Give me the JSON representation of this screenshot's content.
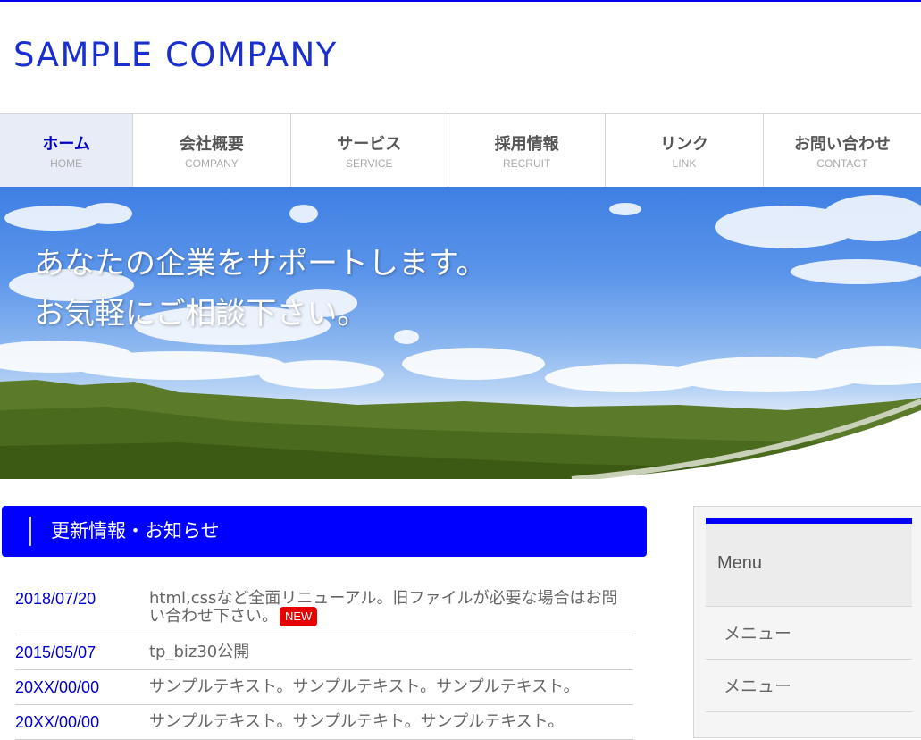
{
  "header": {
    "logo_text": "SAMPLE COMPANY"
  },
  "nav": {
    "items": [
      {
        "label": "ホーム",
        "sub": "HOME",
        "active": true
      },
      {
        "label": "会社概要",
        "sub": "COMPANY",
        "active": false
      },
      {
        "label": "サービス",
        "sub": "SERVICE",
        "active": false
      },
      {
        "label": "採用情報",
        "sub": "RECRUIT",
        "active": false
      },
      {
        "label": "リンク",
        "sub": "LINK",
        "active": false
      },
      {
        "label": "お問い合わせ",
        "sub": "CONTACT",
        "active": false
      }
    ]
  },
  "hero": {
    "line1": "あなたの企業をサポートします。",
    "line2": "お気軽にご相談下さい。"
  },
  "news": {
    "heading": "更新情報・お知らせ",
    "items": [
      {
        "date": "2018/07/20",
        "text": "html,cssなど全面リニューアル。旧ファイルが必要な場合はお問い合わせ下さい。",
        "badge": "NEW"
      },
      {
        "date": "2015/05/07",
        "text": "tp_biz30公開"
      },
      {
        "date": "20XX/00/00",
        "text": "サンプルテキスト。サンプルテキスト。サンプルテキスト。"
      },
      {
        "date": "20XX/00/00",
        "text": "サンプルテキスト。サンプルテキト。サンプルテキスト。"
      }
    ]
  },
  "sidebar": {
    "heading": "Menu",
    "items": [
      {
        "label": "メニュー"
      },
      {
        "label": "メニュー"
      }
    ]
  },
  "colors": {
    "accent": "#0000ff",
    "logo": "#1a2fd0",
    "date": "#0000cc",
    "badge": "#e60000"
  }
}
